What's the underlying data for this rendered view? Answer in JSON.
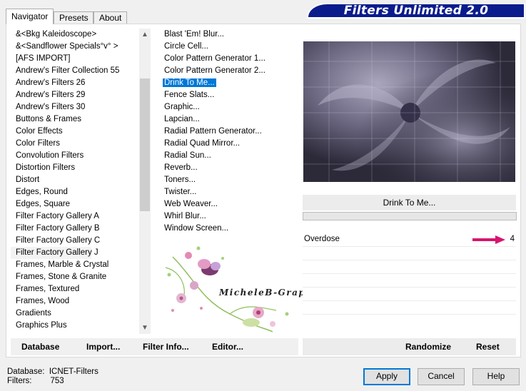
{
  "banner": {
    "title": "Filters Unlimited 2.0"
  },
  "tabs": [
    {
      "label": "Navigator",
      "active": true
    },
    {
      "label": "Presets",
      "active": false
    },
    {
      "label": "About",
      "active": false
    }
  ],
  "categories": [
    "&<Bkg Kaleidoscope>",
    "&<Sandflower Specials°v° >",
    "[AFS IMPORT]",
    "Andrew's Filter Collection 55",
    "Andrew's Filters 26",
    "Andrew's Filters 29",
    "Andrew's Filters 30",
    "Buttons & Frames",
    "Color Effects",
    "Color Filters",
    "Convolution Filters",
    "Distortion Filters",
    "Distort",
    "Edges, Round",
    "Edges, Square",
    "Filter Factory Gallery A",
    "Filter Factory Gallery B",
    "Filter Factory Gallery C",
    "Filter Factory Gallery J",
    "Frames, Marble & Crystal",
    "Frames, Stone & Granite",
    "Frames, Textured",
    "Frames, Wood",
    "Gradients",
    "Graphics Plus"
  ],
  "selected_category": "Filter Factory Gallery J",
  "filters": [
    "Blast 'Em! Blur...",
    "Circle Cell...",
    "Color Pattern Generator 1...",
    "Color Pattern Generator 2...",
    "Drink To Me...",
    "Fence Slats...",
    "Graphic...",
    "Lapcian...",
    "Radial Pattern Generator...",
    "Radial Quad Mirror...",
    "Radial Sun...",
    "Reverb...",
    "Toners...",
    "Twister...",
    "Web Weaver...",
    "Whirl Blur...",
    "Window Screen..."
  ],
  "selected_filter": "Drink To Me...",
  "left_buttons": {
    "database": "Database",
    "import": "Import...",
    "filter_info": "Filter Info...",
    "editor": "Editor..."
  },
  "preview": {
    "filter_name": "Drink To Me..."
  },
  "params": [
    {
      "label": "Overdose",
      "value": "4"
    }
  ],
  "right_buttons": {
    "randomize": "Randomize",
    "reset": "Reset"
  },
  "footer": {
    "database_label": "Database:",
    "database_value": "ICNET-Filters",
    "filters_label": "Filters:",
    "filters_value": "753"
  },
  "dialog_buttons": {
    "apply": "Apply",
    "cancel": "Cancel",
    "help": "Help"
  },
  "watermark_text": "MicheleB-Graphisme",
  "colors": {
    "banner": "#0a1c8c",
    "selection": "#0078d7",
    "arrow": "#d6156e"
  }
}
